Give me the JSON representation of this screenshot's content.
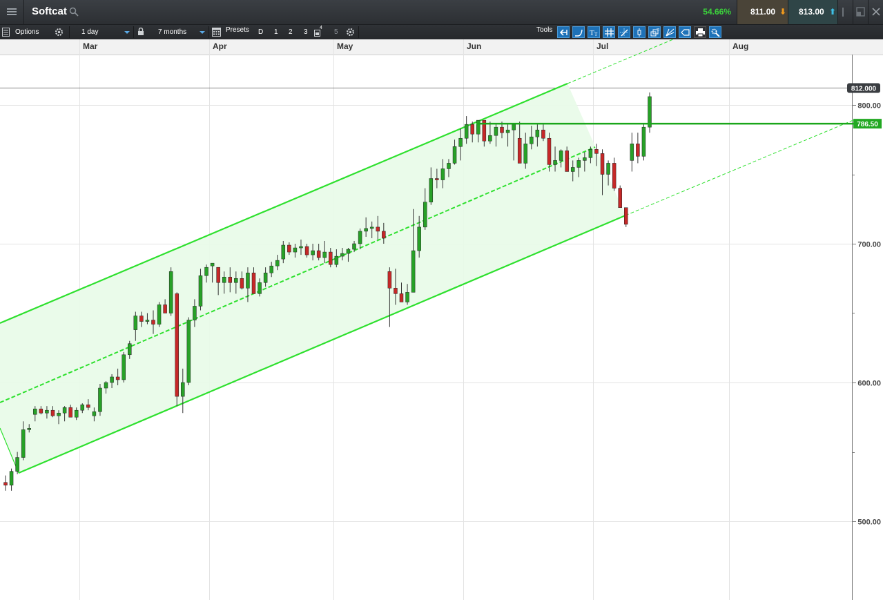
{
  "header": {
    "instrument": "Softcat",
    "change_pct": "54.66%",
    "sell_price": "811.00",
    "buy_price": "813.00",
    "sell_arrow": "⬇",
    "buy_arrow": "⬆",
    "icons": [
      "menu-icon",
      "search-icon",
      "popout-icon",
      "close-icon"
    ]
  },
  "toolbar": {
    "options_label": "Options",
    "interval": "1 day",
    "period": "7 months",
    "presets_label": "Presets",
    "presets": [
      "D",
      "1",
      "2",
      "3",
      "4",
      "5"
    ],
    "tools_label": "Tools",
    "tools": [
      "back-arrow-tool",
      "curve-tool",
      "text-tool",
      "grid-tool",
      "crosshair-tool",
      "candle-tool",
      "layers-tool",
      "fib-tool",
      "tag-tool",
      "print-tool",
      "settings-tool"
    ],
    "accent": "#1e72b8"
  },
  "chart_data": {
    "type": "candlestick",
    "x_axis_labels": [
      "Mar",
      "Apr",
      "May",
      "Jun",
      "Jul",
      "Aug"
    ],
    "y_axis_labels": [
      "800.00",
      "700.00",
      "600.00",
      "500.00"
    ],
    "y_range": [
      460,
      830
    ],
    "current_price_tag": "812.000",
    "horizontal_line_tag": "786.50",
    "horizontal_line_value": 786.5,
    "colors": {
      "up": "#27a127",
      "down": "#c62828",
      "channel": "#2ee02e",
      "fill": "#e8fbe8"
    },
    "candles_ohlc": [
      [
        528,
        533,
        522,
        526
      ],
      [
        526,
        538,
        522,
        536
      ],
      [
        536,
        550,
        534,
        546
      ],
      [
        546,
        572,
        544,
        566
      ],
      [
        566,
        570,
        564,
        567
      ],
      [
        577,
        583,
        572,
        581
      ],
      [
        581,
        583,
        577,
        578
      ],
      [
        578,
        583,
        574,
        580
      ],
      [
        580,
        583,
        575,
        576
      ],
      [
        576,
        580,
        570,
        578
      ],
      [
        578,
        583,
        572,
        582
      ],
      [
        582,
        584,
        579,
        575
      ],
      [
        575,
        582,
        573,
        580
      ],
      [
        580,
        585,
        578,
        584
      ],
      [
        584,
        588,
        580,
        582
      ],
      [
        576,
        582,
        572,
        579
      ],
      [
        579,
        599,
        576,
        596
      ],
      [
        596,
        601,
        592,
        600
      ],
      [
        600,
        606,
        596,
        604
      ],
      [
        604,
        610,
        598,
        602
      ],
      [
        602,
        622,
        600,
        620
      ],
      [
        620,
        630,
        617,
        628
      ],
      [
        638,
        651,
        630,
        648
      ],
      [
        648,
        651,
        640,
        644
      ],
      [
        644,
        650,
        642,
        645
      ],
      [
        645,
        652,
        635,
        642
      ],
      [
        642,
        658,
        640,
        656
      ],
      [
        656,
        660,
        651,
        650
      ],
      [
        650,
        683,
        648,
        680
      ],
      [
        664,
        665,
        583,
        590
      ],
      [
        590,
        610,
        578,
        600
      ],
      [
        600,
        647,
        598,
        645
      ],
      [
        645,
        660,
        640,
        655
      ],
      [
        655,
        682,
        652,
        677
      ],
      [
        677,
        685,
        672,
        683
      ],
      [
        684,
        686,
        672,
        686
      ],
      [
        683,
        683,
        663,
        672
      ],
      [
        672,
        680,
        664,
        676
      ],
      [
        676,
        683,
        665,
        672
      ],
      [
        672,
        680,
        664,
        675
      ],
      [
        675,
        680,
        667,
        668
      ],
      [
        668,
        683,
        658,
        679
      ],
      [
        679,
        683,
        664,
        664
      ],
      [
        664,
        675,
        662,
        672
      ],
      [
        672,
        683,
        669,
        679
      ],
      [
        679,
        687,
        676,
        684
      ],
      [
        684,
        692,
        681,
        688
      ],
      [
        689,
        702,
        686,
        699
      ],
      [
        699,
        701,
        692,
        694
      ],
      [
        694,
        700,
        690,
        697
      ],
      [
        697,
        703,
        692,
        698
      ],
      [
        698,
        700,
        690,
        692
      ],
      [
        692,
        700,
        688,
        695
      ],
      [
        695,
        700,
        688,
        690
      ],
      [
        690,
        702,
        686,
        694
      ],
      [
        694,
        697,
        683,
        685
      ],
      [
        685,
        696,
        683,
        691
      ],
      [
        691,
        697,
        688,
        693
      ],
      [
        693,
        697,
        687,
        696
      ],
      [
        696,
        702,
        694,
        700
      ],
      [
        700,
        711,
        696,
        709
      ],
      [
        709,
        719,
        705,
        711
      ],
      [
        711,
        716,
        704,
        712
      ],
      [
        712,
        720,
        703,
        709
      ],
      [
        709,
        715,
        700,
        704
      ],
      [
        680,
        683,
        640,
        668
      ],
      [
        668,
        682,
        656,
        664
      ],
      [
        664,
        672,
        658,
        658
      ],
      [
        658,
        671,
        656,
        665
      ],
      [
        665,
        725,
        665,
        695
      ],
      [
        695,
        720,
        690,
        712
      ],
      [
        712,
        740,
        710,
        730
      ],
      [
        730,
        755,
        728,
        747
      ],
      [
        747,
        754,
        740,
        746
      ],
      [
        746,
        761,
        740,
        754
      ],
      [
        754,
        761,
        748,
        758
      ],
      [
        758,
        775,
        757,
        770
      ],
      [
        770,
        783,
        760,
        776
      ],
      [
        776,
        792,
        772,
        786
      ],
      [
        786,
        788,
        773,
        779
      ],
      [
        779,
        788,
        773,
        789
      ],
      [
        789,
        782,
        770,
        774
      ],
      [
        774,
        788,
        772,
        778
      ],
      [
        778,
        786,
        770,
        784
      ],
      [
        784,
        788,
        776,
        780
      ],
      [
        780,
        786,
        770,
        782
      ],
      [
        782,
        785,
        760,
        786
      ],
      [
        776,
        788,
        770,
        758
      ],
      [
        758,
        780,
        754,
        772
      ],
      [
        772,
        785,
        768,
        777
      ],
      [
        777,
        786,
        770,
        782
      ],
      [
        782,
        786,
        774,
        776
      ],
      [
        776,
        780,
        752,
        757
      ],
      [
        757,
        770,
        752,
        760
      ],
      [
        760,
        768,
        755,
        767
      ],
      [
        767,
        770,
        752,
        752
      ],
      [
        752,
        760,
        745,
        755
      ],
      [
        755,
        762,
        748,
        760
      ],
      [
        760,
        766,
        752,
        762
      ],
      [
        762,
        770,
        758,
        768
      ],
      [
        768,
        772,
        756,
        765
      ],
      [
        765,
        768,
        735,
        750
      ],
      [
        750,
        760,
        742,
        758
      ],
      [
        758,
        762,
        738,
        740
      ],
      [
        740,
        742,
        730,
        726
      ],
      [
        726,
        722,
        712,
        714
      ],
      [
        760,
        780,
        752,
        772
      ],
      [
        772,
        780,
        758,
        763
      ],
      [
        763,
        787,
        760,
        784
      ],
      [
        784,
        809,
        780,
        806
      ]
    ],
    "channel_lines": "upper, middle (dashed), lower trend channel with dashed extensions"
  }
}
